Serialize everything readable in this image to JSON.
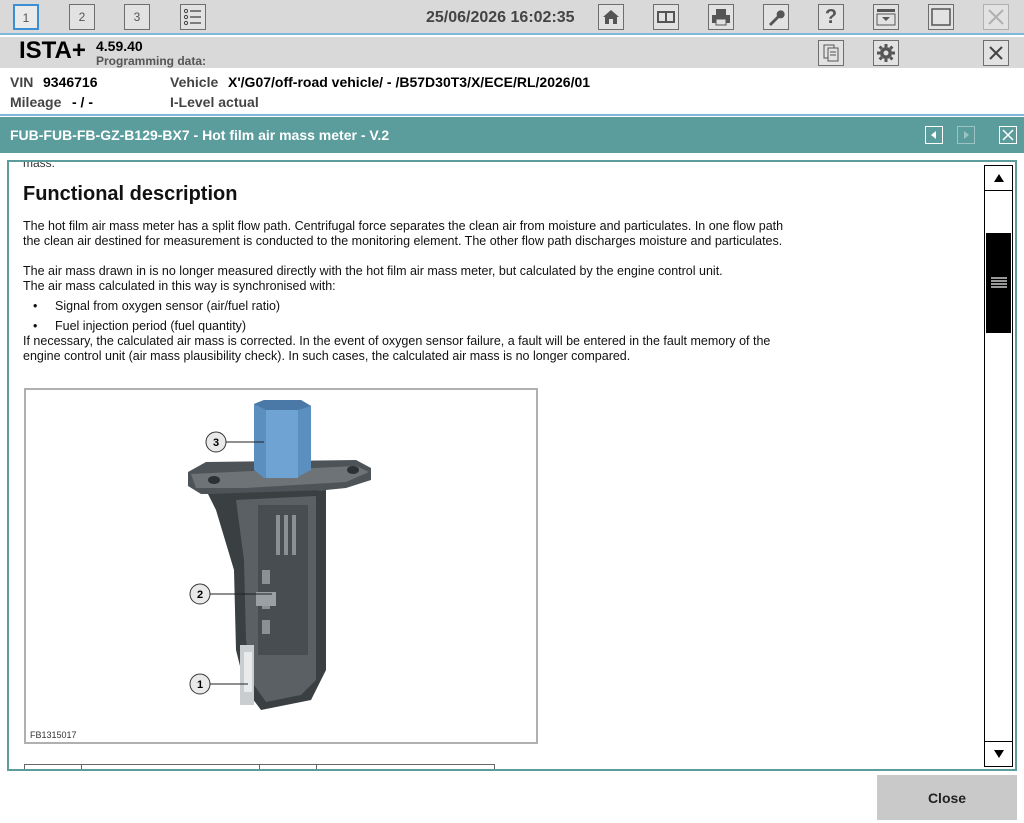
{
  "toolbar": {
    "tabs": [
      "1",
      "2",
      "3"
    ],
    "datetime": "25/06/2026 16:02:35"
  },
  "header": {
    "app_name": "ISTA+",
    "version": "4.59.40",
    "programming_label": "Programming data:"
  },
  "vehicle": {
    "vin_label": "VIN",
    "vin": "9346716",
    "vehicle_label": "Vehicle",
    "vehicle_value": "X'/G07/off-road vehicle/ - /B57D30T3/X/ECE/RL/2026/01",
    "mileage_label": "Mileage",
    "mileage_value": "- / -",
    "ilevel_label": "I-Level actual"
  },
  "document": {
    "title": "FUB-FUB-FB-GZ-B129-BX7 - Hot film air mass meter - V.2",
    "cut_text": "mass.",
    "heading": "Functional description",
    "para1": "The hot film air mass meter has a split flow path. Centrifugal force separates the clean air from moisture and particulates. In one flow path the clean air destined for measurement is conducted to the monitoring element. The other flow path discharges moisture and particulates.",
    "para2": "The air mass drawn in is no longer measured directly with the hot film air mass meter, but calculated by the engine control unit.",
    "para3": "The air mass calculated in this way is synchronised with:",
    "bullets": [
      "Signal from oxygen sensor (air/fuel ratio)",
      "Fuel injection period (fuel quantity)"
    ],
    "para4": "If necessary, the calculated air mass is corrected. In the event of oxygen sensor failure, a fault will be entered in the fault memory of the engine control unit (air mass plausibility check). In such cases, the calculated air mass is no longer compared.",
    "figure": {
      "code": "FB1315017",
      "callouts": [
        "3",
        "2",
        "1"
      ]
    }
  },
  "footer": {
    "close_label": "Close"
  },
  "colors": {
    "accent": "#5b9c9c",
    "toolbar_bg": "#d9d9d9",
    "divider": "#7fb7da"
  }
}
